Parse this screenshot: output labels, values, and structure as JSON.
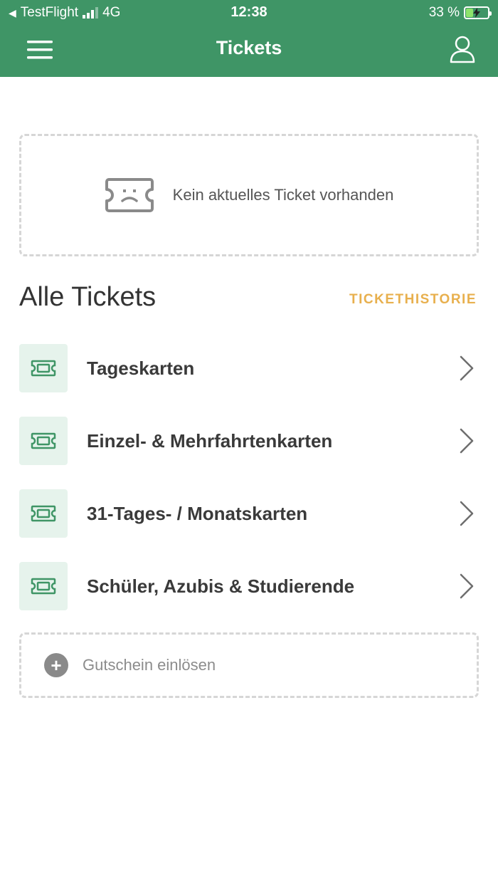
{
  "status_bar": {
    "carrier": "TestFlight",
    "network": "4G",
    "time": "12:38",
    "battery": "33 %",
    "battery_level": 0.33
  },
  "header": {
    "title": "Tickets",
    "menu_icon": "hamburger-icon",
    "profile_icon": "user-icon",
    "background_color": "#3f9566"
  },
  "current_ticket": {
    "empty_text": "Kein aktuelles Ticket vorhanden",
    "icon": "sad-ticket-icon"
  },
  "all_tickets": {
    "title": "Alle Tickets",
    "history_label": "TICKETHISTORIE",
    "items": [
      {
        "label": "Tageskarten",
        "icon": "ticket-icon"
      },
      {
        "label": "Einzel- & Mehrfahrtenkarten",
        "icon": "ticket-icon"
      },
      {
        "label": "31-Tages- / Monatskarten",
        "icon": "ticket-icon"
      },
      {
        "label": "Schüler, Azubis & Studierende",
        "icon": "ticket-icon"
      }
    ]
  },
  "voucher": {
    "label": "Gutschein einlösen",
    "icon": "plus-circle-icon"
  },
  "colors": {
    "brand_green": "#3f9566",
    "accent_orange": "#e8b04e",
    "icon_bg": "#e6f3ec"
  }
}
